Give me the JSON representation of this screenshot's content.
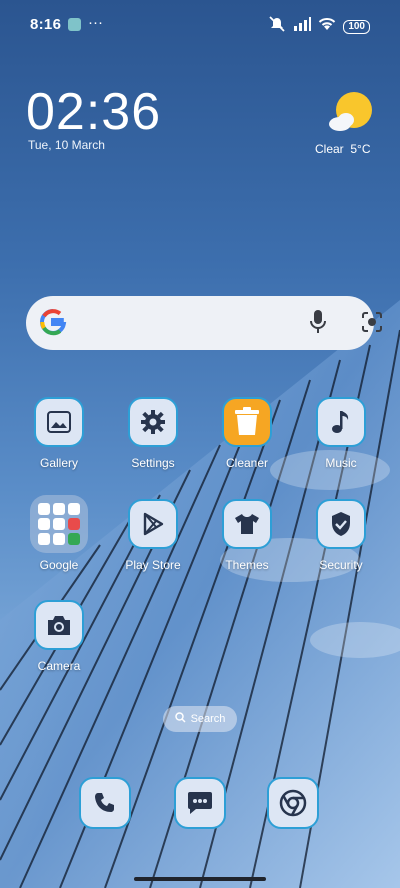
{
  "status": {
    "time": "8:16",
    "more": "···",
    "battery": "100"
  },
  "clock": {
    "time": "02:36",
    "date": "Tue, 10 March"
  },
  "weather": {
    "condition": "Clear",
    "temp": "5°C"
  },
  "search": {
    "label": "Search"
  },
  "apps": [
    {
      "name": "Gallery"
    },
    {
      "name": "Settings"
    },
    {
      "name": "Cleaner"
    },
    {
      "name": "Music"
    },
    {
      "name": "Google"
    },
    {
      "name": "Play Store"
    },
    {
      "name": "Themes"
    },
    {
      "name": "Security"
    },
    {
      "name": "Camera"
    }
  ],
  "dock": [
    "phone-icon",
    "messages-icon",
    "chrome-icon"
  ],
  "colors": {
    "accent": "#2d9fd6",
    "tile": "#dde6f4",
    "cleaner": "#f6a623"
  }
}
